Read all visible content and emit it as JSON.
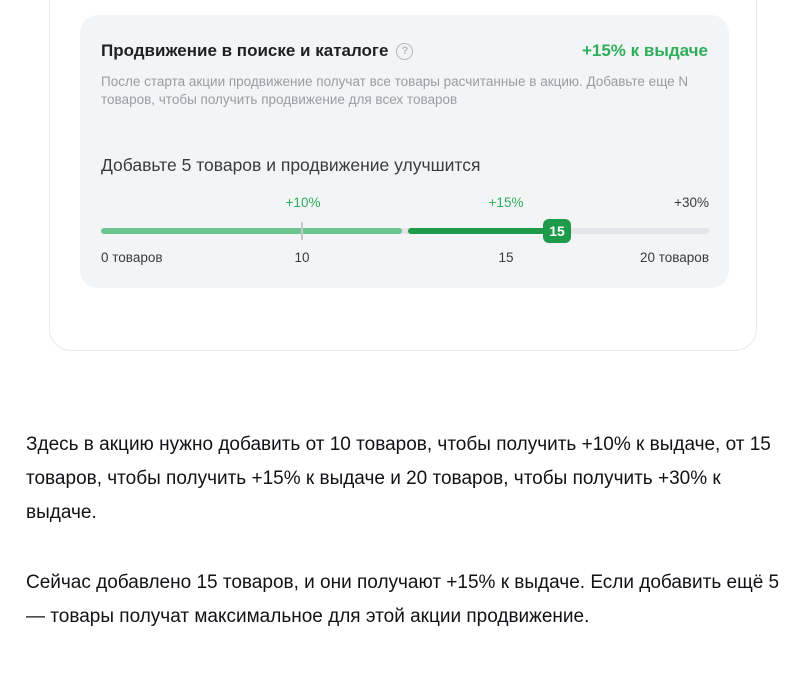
{
  "promo": {
    "title": "Продвижение в поиске и каталоге",
    "help_icon": "?",
    "badge": "+15% к выдаче",
    "description": "После старта акции продвижение получат все товары расчитанные в акцию. Добавьте еще N товаров, чтобы получить продвижение для всех товаров",
    "add_more": "Добавьте 5 товаров и продвижение улучшится",
    "progress": {
      "current": 15,
      "max": 20,
      "current_label": "15",
      "top_labels": [
        "+10%",
        "+15%",
        "+30%"
      ],
      "bottom_labels": [
        "0 товаров",
        "10",
        "15",
        "20 товаров"
      ]
    },
    "colors": {
      "accent": "#2fae5b",
      "fill_dark": "#1e9a4b",
      "fill_light": "#6bc58e",
      "track": "#e4e5ea"
    }
  },
  "explanation": {
    "paragraph_1": "Здесь в акцию нужно добавить от 10 товаров, чтобы получить +10% к выдаче, от 15 товаров, чтобы получить +15% к выдаче и 20 товаров, чтобы получить +30% к выдаче.",
    "paragraph_2": "Сейчас добавлено 15 товаров, и они получают +15% к выдаче. Если добавить ещё 5 — товары получат максимальное для этой акции продвижение."
  }
}
